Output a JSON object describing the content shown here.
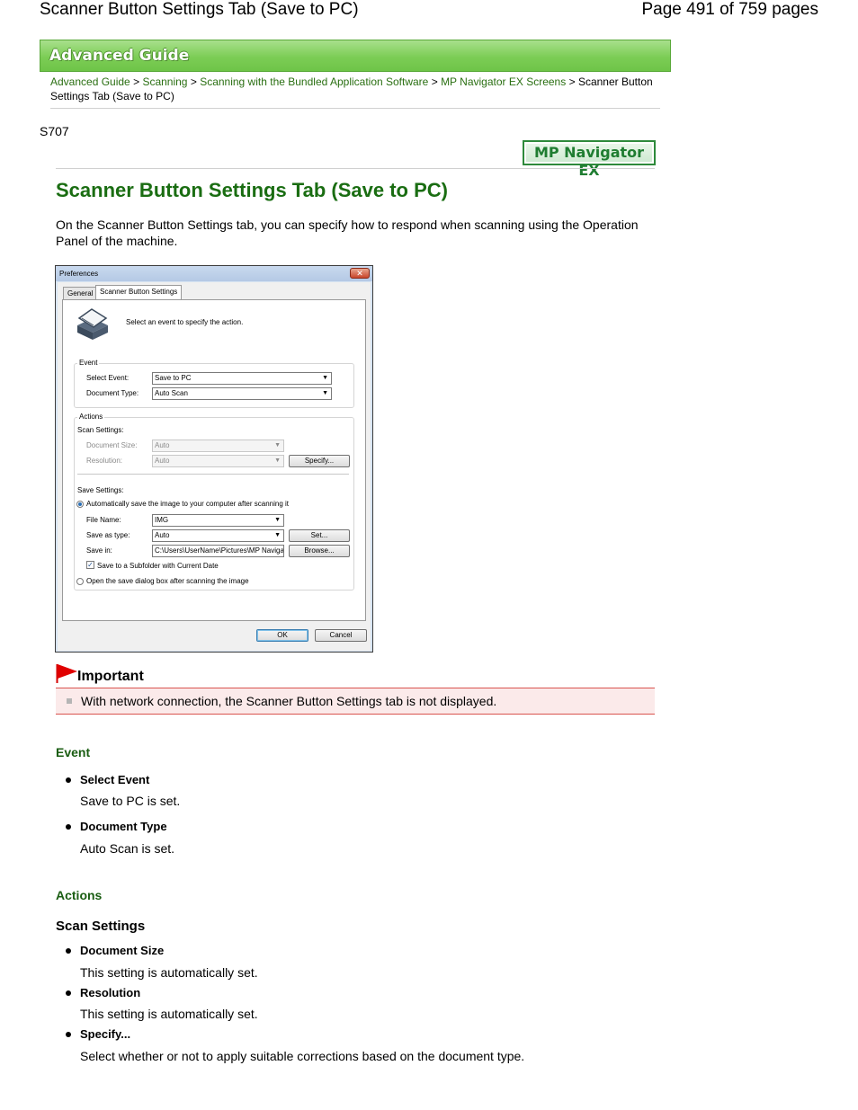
{
  "header": {
    "left_title": "Scanner Button Settings Tab (Save to PC)",
    "page_info": "Page 491 of 759 pages"
  },
  "banner": {
    "title": "Advanced Guide"
  },
  "breadcrumb": {
    "items": [
      "Advanced Guide",
      "Scanning",
      "Scanning with the Bundled Application Software",
      "MP Navigator EX Screens"
    ],
    "current": "Scanner Button Settings Tab (Save to PC)",
    "separator": ">"
  },
  "code": "S707",
  "badge": "MP Navigator EX",
  "page_title": "Scanner Button Settings Tab (Save to PC)",
  "intro": "On the Scanner Button Settings tab, you can specify how to respond when scanning using the Operation Panel of the machine.",
  "dialog": {
    "title": "Preferences",
    "close": "✕",
    "tabs": [
      "General",
      "Scanner Button Settings"
    ],
    "instruction": "Select an event to specify the action.",
    "event_group": "Event",
    "select_event_label": "Select Event:",
    "select_event_value": "Save to PC",
    "doc_type_label": "Document Type:",
    "doc_type_value": "Auto Scan",
    "actions_group": "Actions",
    "scan_settings_label": "Scan Settings:",
    "doc_size_label": "Document Size:",
    "doc_size_value": "Auto",
    "resolution_label": "Resolution:",
    "resolution_value": "Auto",
    "specify_button": "Specify...",
    "save_settings_label": "Save Settings:",
    "auto_save_label": "Automatically save the image to your computer after scanning it",
    "file_name_label": "File Name:",
    "file_name_value": "IMG",
    "save_as_label": "Save as type:",
    "save_as_value": "Auto",
    "set_button": "Set...",
    "save_in_label": "Save in:",
    "save_in_value": "C:\\Users\\UserName\\Pictures\\MP Navigato",
    "browse_button": "Browse...",
    "subfolder_label": "Save to a Subfolder with Current Date",
    "open_dialog_label": "Open the save dialog box after scanning the image",
    "ok_button": "OK",
    "cancel_button": "Cancel",
    "dropdown_arrow": "▼"
  },
  "important": {
    "heading": "Important",
    "text": "With network connection, the Scanner Button Settings tab is not displayed."
  },
  "event_section": {
    "heading": "Event",
    "items": [
      {
        "term": "Select Event",
        "desc": "Save to PC is set."
      },
      {
        "term": "Document Type",
        "desc": "Auto Scan is set."
      }
    ]
  },
  "actions_section": {
    "heading": "Actions",
    "subheading": "Scan Settings",
    "items": [
      {
        "term": "Document Size",
        "desc": "This setting is automatically set."
      },
      {
        "term": "Resolution",
        "desc": "This setting is automatically set."
      },
      {
        "term": "Specify...",
        "desc": "Select whether or not to apply suitable corrections based on the document type."
      }
    ]
  },
  "colors": {
    "banner_green": "#7ccd55",
    "link_green": "#2a6f12",
    "title_green": "#1a6d12",
    "important_red": "#d9534f",
    "important_bg": "#fbeaea"
  }
}
